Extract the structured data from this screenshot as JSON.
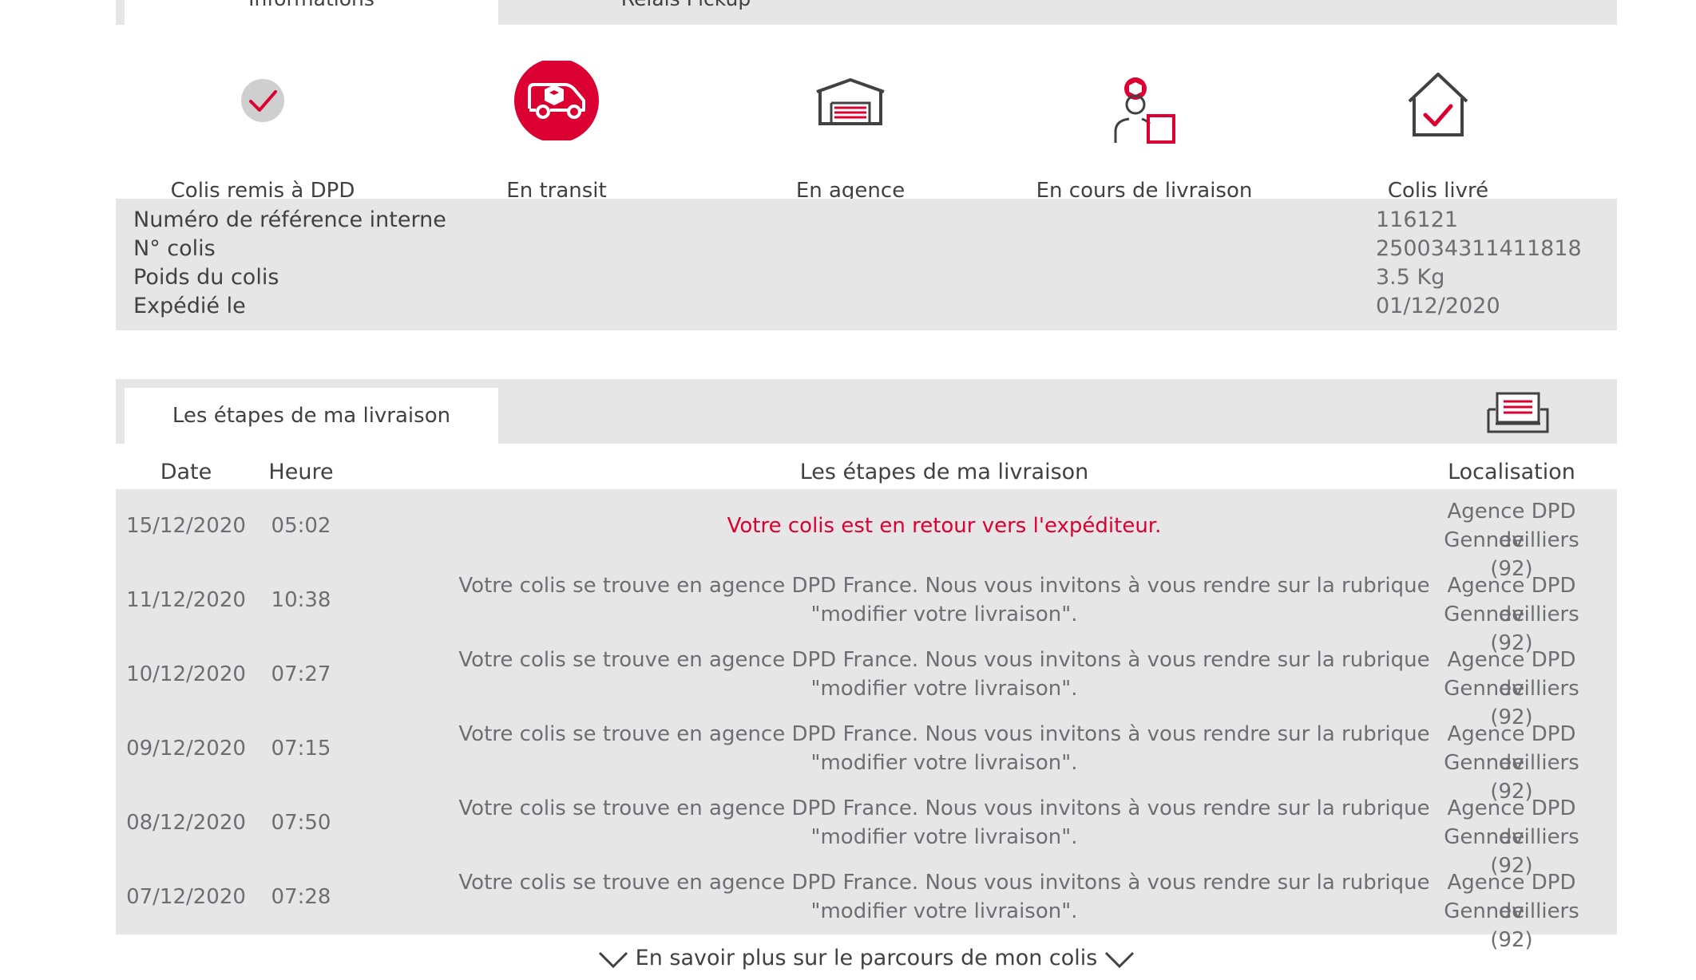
{
  "tabs": {
    "information": "Informations",
    "relais": "Relais Pickup"
  },
  "steps": [
    {
      "label": "Colis remis à DPD",
      "icon": "check-circle-icon"
    },
    {
      "label": "En transit",
      "icon": "van-icon"
    },
    {
      "label": "En agence",
      "icon": "depot-icon"
    },
    {
      "label": "En cours de livraison",
      "icon": "courier-icon"
    },
    {
      "label": "Colis livré",
      "icon": "house-check-icon"
    }
  ],
  "info": [
    {
      "label": "Numéro de référence interne",
      "value": "116121"
    },
    {
      "label": "N° colis",
      "value": "250034311411818"
    },
    {
      "label": "Poids du colis",
      "value": "3.5 Kg"
    },
    {
      "label": "Expédié le",
      "value": "01/12/2020"
    }
  ],
  "etapes": {
    "tab_label": "Les étapes de ma livraison",
    "print_icon": "print-icon",
    "columns": {
      "date": "Date",
      "hour": "Heure",
      "desc": "Les étapes de ma livraison",
      "loc": "Localisation"
    },
    "rows": [
      {
        "date": "15/12/2020",
        "hour": "05:02",
        "desc1": "Votre colis est en retour vers l'expéditeur.",
        "desc2": "",
        "loc1": "Agence DPD de",
        "loc2": "Gennevilliers (92)"
      },
      {
        "date": "11/12/2020",
        "hour": "10:38",
        "desc1": "Votre colis se trouve en agence DPD France. Nous vous invitons à vous rendre sur la rubrique",
        "desc2": "\"modifier votre livraison\".",
        "loc1": "Agence DPD de",
        "loc2": "Gennevilliers (92)"
      },
      {
        "date": "10/12/2020",
        "hour": "07:27",
        "desc1": "Votre colis se trouve en agence DPD France. Nous vous invitons à vous rendre sur la rubrique",
        "desc2": "\"modifier votre livraison\".",
        "loc1": "Agence DPD de",
        "loc2": "Gennevilliers (92)"
      },
      {
        "date": "09/12/2020",
        "hour": "07:15",
        "desc1": "Votre colis se trouve en agence DPD France. Nous vous invitons à vous rendre sur la rubrique",
        "desc2": "\"modifier votre livraison\".",
        "loc1": "Agence DPD de",
        "loc2": "Gennevilliers (92)"
      },
      {
        "date": "08/12/2020",
        "hour": "07:50",
        "desc1": "Votre colis se trouve en agence DPD France. Nous vous invitons à vous rendre sur la rubrique",
        "desc2": "\"modifier votre livraison\".",
        "loc1": "Agence DPD de",
        "loc2": "Gennevilliers (92)"
      },
      {
        "date": "07/12/2020",
        "hour": "07:28",
        "desc1": "Votre colis se trouve en agence DPD France. Nous vous invitons à vous rendre sur la rubrique",
        "desc2": "\"modifier votre livraison\".",
        "loc1": "Agence DPD de",
        "loc2": "Gennevilliers (92)"
      }
    ]
  },
  "more_link": "En savoir plus sur le parcours de mon colis",
  "colors": {
    "accent": "#dc0032",
    "panel": "#e6e6e6",
    "text": "#414042",
    "muted": "#6d6e71"
  }
}
